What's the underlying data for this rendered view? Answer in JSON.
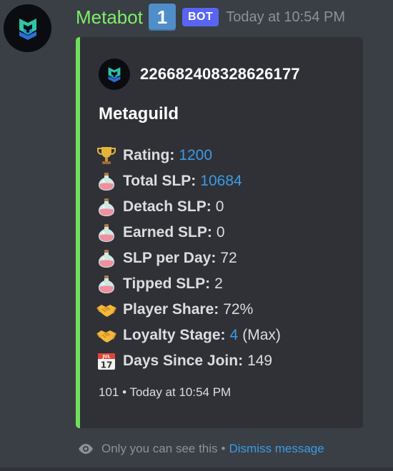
{
  "header": {
    "username": "Metabot",
    "number_badge": "1",
    "bot_tag": "BOT",
    "timestamp": "Today at 10:54 PM"
  },
  "embed": {
    "accent_color": "#6ee05a",
    "author": "226682408328626177",
    "title": "Metaguild",
    "fields": [
      {
        "icon": "trophy-icon",
        "label": "Rating:",
        "value": "1200",
        "value_style": "link",
        "suffix": ""
      },
      {
        "icon": "potion-icon",
        "label": "Total SLP:",
        "value": "10684",
        "value_style": "link",
        "suffix": ""
      },
      {
        "icon": "potion-icon",
        "label": "Detach SLP:",
        "value": "0",
        "value_style": "plain",
        "suffix": ""
      },
      {
        "icon": "potion-icon",
        "label": "Earned SLP:",
        "value": "0",
        "value_style": "plain",
        "suffix": ""
      },
      {
        "icon": "potion-icon",
        "label": "SLP per Day:",
        "value": "72",
        "value_style": "plain",
        "suffix": ""
      },
      {
        "icon": "potion-icon",
        "label": "Tipped SLP:",
        "value": "2",
        "value_style": "plain",
        "suffix": ""
      },
      {
        "icon": "handshake-icon",
        "label": "Player Share:",
        "value": "72%",
        "value_style": "plain",
        "suffix": ""
      },
      {
        "icon": "handshake-icon",
        "label": "Loyalty Stage:",
        "value": "4",
        "value_style": "link",
        "suffix": "(Max)"
      },
      {
        "icon": "calendar-icon",
        "label": "Days Since Join:",
        "value": "149",
        "value_style": "plain",
        "suffix": ""
      }
    ],
    "footer": "101 • Today at 10:54 PM"
  },
  "ephemeral": {
    "text": "Only you can see this",
    "separator": "•",
    "dismiss_label": "Dismiss message"
  },
  "colors": {
    "background": "#3a3e45",
    "embed_background": "#2f3136",
    "username": "#7cf066",
    "link": "#3b9be8",
    "bot_tag": "#5865f2",
    "number_badge": "#4f8ec9"
  }
}
